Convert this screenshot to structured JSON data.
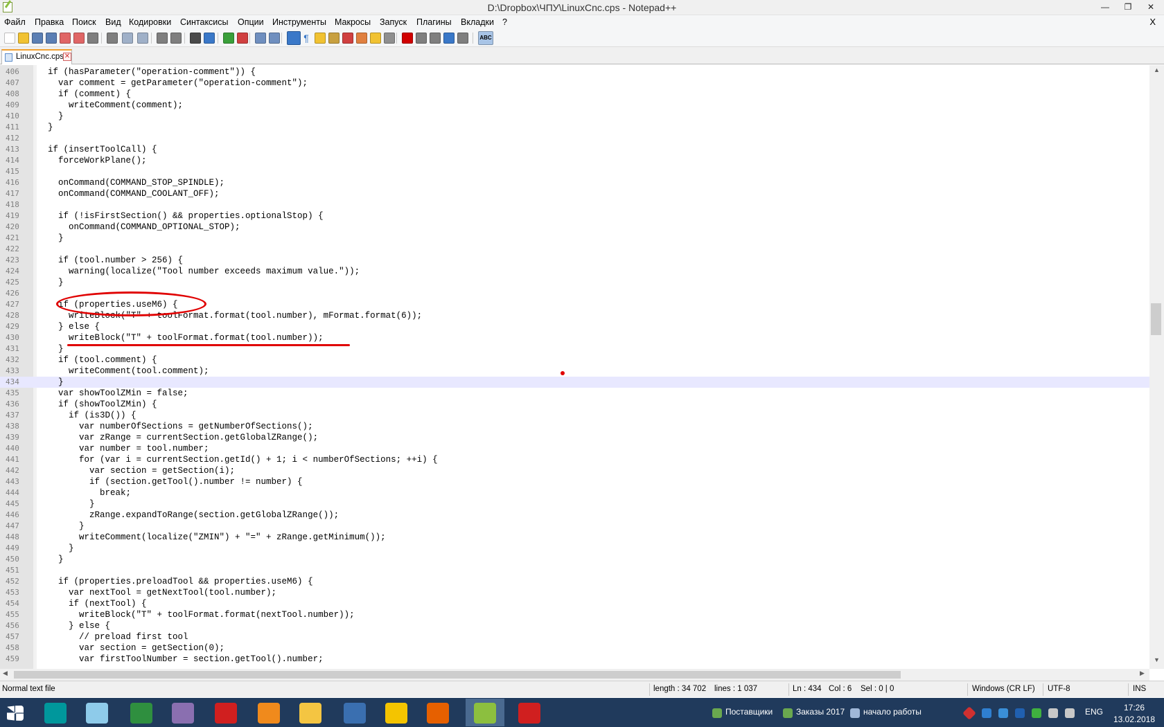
{
  "window": {
    "title": "D:\\Dropbox\\ЧПУ\\LinuxCnc.cps - Notepad++",
    "min_glyph": "—",
    "max_glyph": "❐",
    "close_glyph": "✕"
  },
  "menu": {
    "items": [
      "Файл",
      "Правка",
      "Поиск",
      "Вид",
      "Кодировки",
      "Синтаксисы",
      "Опции",
      "Инструменты",
      "Макросы",
      "Запуск",
      "Плагины",
      "Вкладки",
      "?"
    ],
    "close_glyph": "X"
  },
  "toolbar": {
    "icons": [
      "new-file-icon",
      "open-file-icon",
      "save-icon",
      "save-all-icon",
      "close-icon",
      "close-all-icon",
      "print-icon",
      "cut-icon",
      "copy-icon",
      "paste-icon",
      "undo-icon",
      "redo-icon",
      "find-icon",
      "replace-icon",
      "zoom-in-icon",
      "zoom-out-icon",
      "sync-v-icon",
      "sync-h-icon",
      "word-wrap-icon",
      "show-all-chars-icon",
      "indent-guide-icon",
      "udl-icon",
      "doc-map-icon",
      "function-list-icon",
      "folder-workspace-icon",
      "monitor-icon",
      "record-macro-icon",
      "stop-record-icon",
      "play-macro-icon",
      "run-macro-multiple-icon",
      "save-macro-icon",
      "spellcheck-icon"
    ],
    "spellcheck_label": "ABC",
    "pilcrow": "¶"
  },
  "tab": {
    "label": "LinuxCnc.cps",
    "close_glyph": "✕"
  },
  "editor": {
    "caret_line": 434,
    "lines": [
      {
        "n": "406",
        "t": "  if (hasParameter(\"operation-comment\")) {"
      },
      {
        "n": "407",
        "t": "    var comment = getParameter(\"operation-comment\");"
      },
      {
        "n": "408",
        "t": "    if (comment) {"
      },
      {
        "n": "409",
        "t": "      writeComment(comment);"
      },
      {
        "n": "410",
        "t": "    }"
      },
      {
        "n": "411",
        "t": "  }"
      },
      {
        "n": "412",
        "t": ""
      },
      {
        "n": "413",
        "t": "  if (insertToolCall) {"
      },
      {
        "n": "414",
        "t": "    forceWorkPlane();"
      },
      {
        "n": "415",
        "t": ""
      },
      {
        "n": "416",
        "t": "    onCommand(COMMAND_STOP_SPINDLE);"
      },
      {
        "n": "417",
        "t": "    onCommand(COMMAND_COOLANT_OFF);"
      },
      {
        "n": "418",
        "t": ""
      },
      {
        "n": "419",
        "t": "    if (!isFirstSection() && properties.optionalStop) {"
      },
      {
        "n": "420",
        "t": "      onCommand(COMMAND_OPTIONAL_STOP);"
      },
      {
        "n": "421",
        "t": "    }"
      },
      {
        "n": "422",
        "t": ""
      },
      {
        "n": "423",
        "t": "    if (tool.number > 256) {"
      },
      {
        "n": "424",
        "t": "      warning(localize(\"Tool number exceeds maximum value.\"));"
      },
      {
        "n": "425",
        "t": "    }"
      },
      {
        "n": "426",
        "t": ""
      },
      {
        "n": "427",
        "t": "    if (properties.useM6) {"
      },
      {
        "n": "428",
        "t": "      writeBlock(\"T\" + toolFormat.format(tool.number), mFormat.format(6));"
      },
      {
        "n": "429",
        "t": "    } else {"
      },
      {
        "n": "430",
        "t": "      writeBlock(\"T\" + toolFormat.format(tool.number));"
      },
      {
        "n": "431",
        "t": "    }"
      },
      {
        "n": "432",
        "t": "    if (tool.comment) {"
      },
      {
        "n": "433",
        "t": "      writeComment(tool.comment);"
      },
      {
        "n": "434",
        "t": "    }"
      },
      {
        "n": "435",
        "t": "    var showToolZMin = false;"
      },
      {
        "n": "436",
        "t": "    if (showToolZMin) {"
      },
      {
        "n": "437",
        "t": "      if (is3D()) {"
      },
      {
        "n": "438",
        "t": "        var numberOfSections = getNumberOfSections();"
      },
      {
        "n": "439",
        "t": "        var zRange = currentSection.getGlobalZRange();"
      },
      {
        "n": "440",
        "t": "        var number = tool.number;"
      },
      {
        "n": "441",
        "t": "        for (var i = currentSection.getId() + 1; i < numberOfSections; ++i) {"
      },
      {
        "n": "442",
        "t": "          var section = getSection(i);"
      },
      {
        "n": "443",
        "t": "          if (section.getTool().number != number) {"
      },
      {
        "n": "444",
        "t": "            break;"
      },
      {
        "n": "445",
        "t": "          }"
      },
      {
        "n": "446",
        "t": "          zRange.expandToRange(section.getGlobalZRange());"
      },
      {
        "n": "447",
        "t": "        }"
      },
      {
        "n": "448",
        "t": "        writeComment(localize(\"ZMIN\") + \"=\" + zRange.getMinimum());"
      },
      {
        "n": "449",
        "t": "      }"
      },
      {
        "n": "450",
        "t": "    }"
      },
      {
        "n": "451",
        "t": ""
      },
      {
        "n": "452",
        "t": "    if (properties.preloadTool && properties.useM6) {"
      },
      {
        "n": "453",
        "t": "      var nextTool = getNextTool(tool.number);"
      },
      {
        "n": "454",
        "t": "      if (nextTool) {"
      },
      {
        "n": "455",
        "t": "        writeBlock(\"T\" + toolFormat.format(nextTool.number));"
      },
      {
        "n": "456",
        "t": "      } else {"
      },
      {
        "n": "457",
        "t": "        // preload first tool"
      },
      {
        "n": "458",
        "t": "        var section = getSection(0);"
      },
      {
        "n": "459",
        "t": "        var firstToolNumber = section.getTool().number;"
      }
    ]
  },
  "statusbar": {
    "file_type": "Normal text file",
    "length": "length : 34 702",
    "lines": "lines : 1 037",
    "ln": "Ln : 434",
    "col": "Col : 6",
    "sel": "Sel : 0 | 0",
    "eol": "Windows (CR LF)",
    "encoding": "UTF-8",
    "mode": "INS"
  },
  "taskbar": {
    "apps": [
      {
        "name": "start-button",
        "color": "#ffffff"
      },
      {
        "name": "arduino-app",
        "color": "#00979c"
      },
      {
        "name": "3d-box-app",
        "color": "#8ecbea"
      },
      {
        "name": "v5-app",
        "color": "#2f8f3f"
      },
      {
        "name": "satellite-app",
        "color": "#8a6fb0"
      },
      {
        "name": "solidworks-2015-app",
        "color": "#d01f1f"
      },
      {
        "name": "fusion-360-app",
        "color": "#f08a1c"
      },
      {
        "name": "file-explorer-app",
        "color": "#f4c542"
      },
      {
        "name": "thunderbird-app",
        "color": "#3a6fb0"
      },
      {
        "name": "1c-app",
        "color": "#f4c400"
      },
      {
        "name": "firefox-app",
        "color": "#e66000"
      },
      {
        "name": "notepadpp-app",
        "color": "#8cbf3f"
      },
      {
        "name": "red-diamond-app",
        "color": "#d01f1f"
      }
    ],
    "toolbar_links": [
      "Поставщики",
      "Заказы 2017",
      "начало работы"
    ],
    "lang": "ENG",
    "time": "17:26",
    "date": "13.02.2018"
  }
}
